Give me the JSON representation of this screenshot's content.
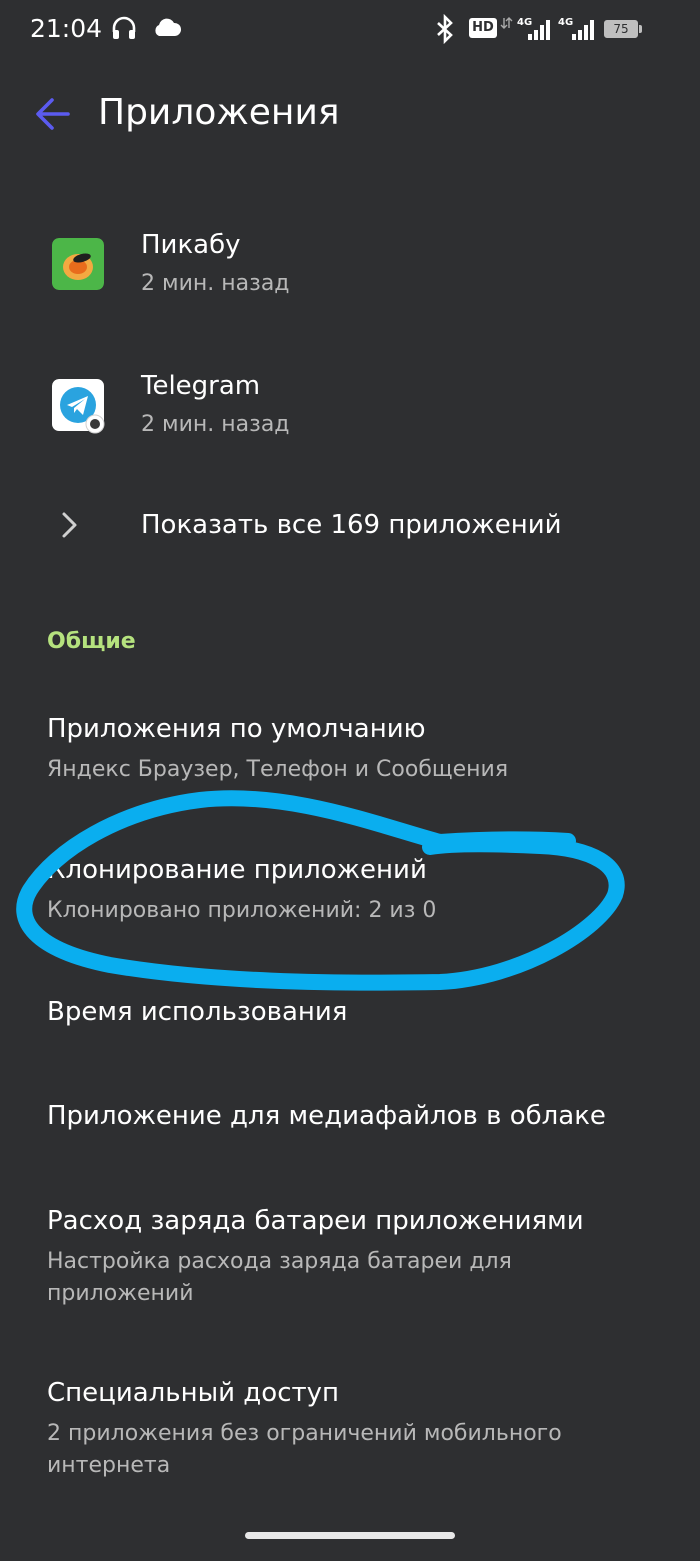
{
  "status_bar": {
    "time": "21:04",
    "hd": "HD",
    "network1": "4G",
    "network2": "4G",
    "battery": "75",
    "icons": [
      "headphones-icon",
      "cloud-icon",
      "bluetooth-icon",
      "signal-icon",
      "battery-icon"
    ]
  },
  "header": {
    "title": "Приложения",
    "back_icon": "arrow-left-icon"
  },
  "recent_apps": [
    {
      "name": "Пикабу",
      "time": "2 мин. назад",
      "icon": "pikabu-app-icon",
      "color": "#4cb648"
    },
    {
      "name": "Telegram",
      "time": "2 мин. назад",
      "icon": "telegram-app-icon",
      "color": "#2aa3df"
    }
  ],
  "show_all": {
    "label": "Показать все 169 приложений"
  },
  "section": {
    "title": "Общие"
  },
  "items": [
    {
      "title": "Приложения по умолчанию",
      "subtitle": "Яндекс Браузер, Телефон и Сообщения"
    },
    {
      "title": "Клонирование приложений",
      "subtitle": "Клонировано приложений: 2 из 0"
    },
    {
      "title": "Время использования",
      "subtitle": ""
    },
    {
      "title": "Приложение для медиафайлов в облаке",
      "subtitle": ""
    },
    {
      "title": "Расход заряда батареи приложениями",
      "subtitle": "Настройка расхода заряда батареи для приложений"
    },
    {
      "title": "Специальный доступ",
      "subtitle": "2 приложения без ограничений мобильного интернета"
    }
  ],
  "colors": {
    "background": "#2e2f31",
    "accent": "#5b5bf0",
    "section": "#b5e27e",
    "annotation": "#0aaeef"
  }
}
